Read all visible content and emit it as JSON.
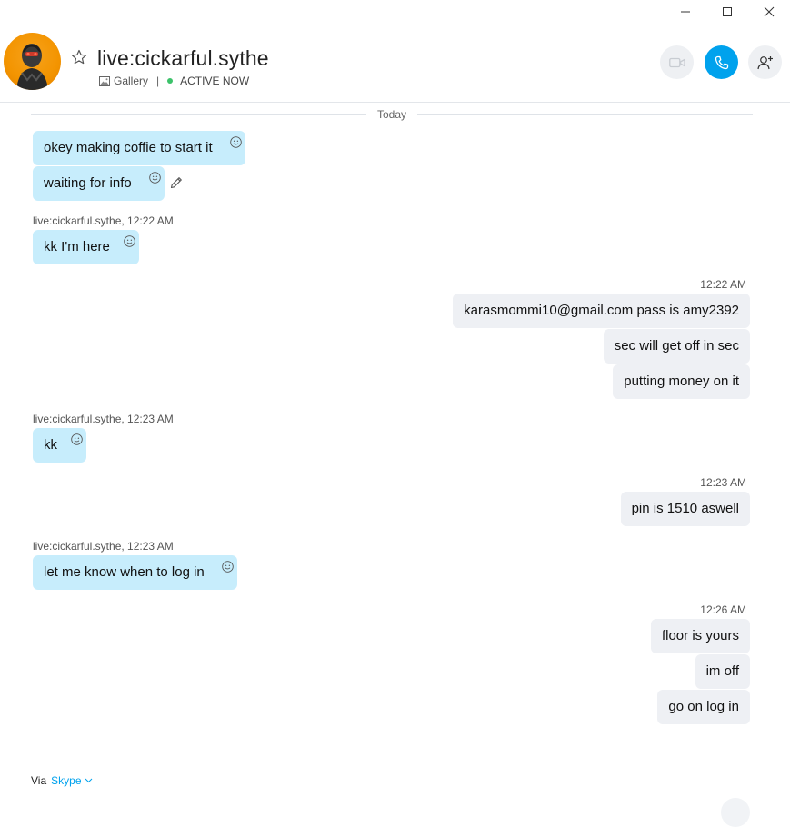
{
  "window": {
    "controls": [
      "minimize",
      "maximize",
      "close"
    ]
  },
  "header": {
    "contact_name": "live:cickarful.sythe",
    "gallery_label": "Gallery",
    "separator": "|",
    "status": "ACTIVE NOW",
    "status_color": "#3cc26a",
    "call_button_color": "#00a2ed"
  },
  "conversation": {
    "day_divider": "Today",
    "blocks": [
      {
        "meta": "",
        "messages": [
          "okey making coffie to start it",
          "waiting for info"
        ]
      },
      {
        "meta": "live:cickarful.sythe, 12:22 AM",
        "messages": [
          "kk I'm here"
        ]
      },
      {
        "meta": "12:22 AM",
        "messages": [
          "karasmommi10@gmail.com pass is amy2392",
          "sec will get off in sec",
          "putting money on it"
        ]
      },
      {
        "meta": "live:cickarful.sythe, 12:23 AM",
        "messages": [
          "kk"
        ]
      },
      {
        "meta": "12:23 AM",
        "messages": [
          "pin is 1510 aswell"
        ]
      },
      {
        "meta": "live:cickarful.sythe, 12:23 AM",
        "messages": [
          "let me know when to log in"
        ]
      },
      {
        "meta": "12:26 AM",
        "messages": [
          "floor is yours",
          "im off",
          "go on log in"
        ]
      }
    ]
  },
  "footer": {
    "via_label": "Via",
    "service_label": "Skype"
  },
  "colors": {
    "incoming_bubble": "#c7edfc",
    "outgoing_bubble": "#eef0f4",
    "accent": "#00a2ed"
  }
}
